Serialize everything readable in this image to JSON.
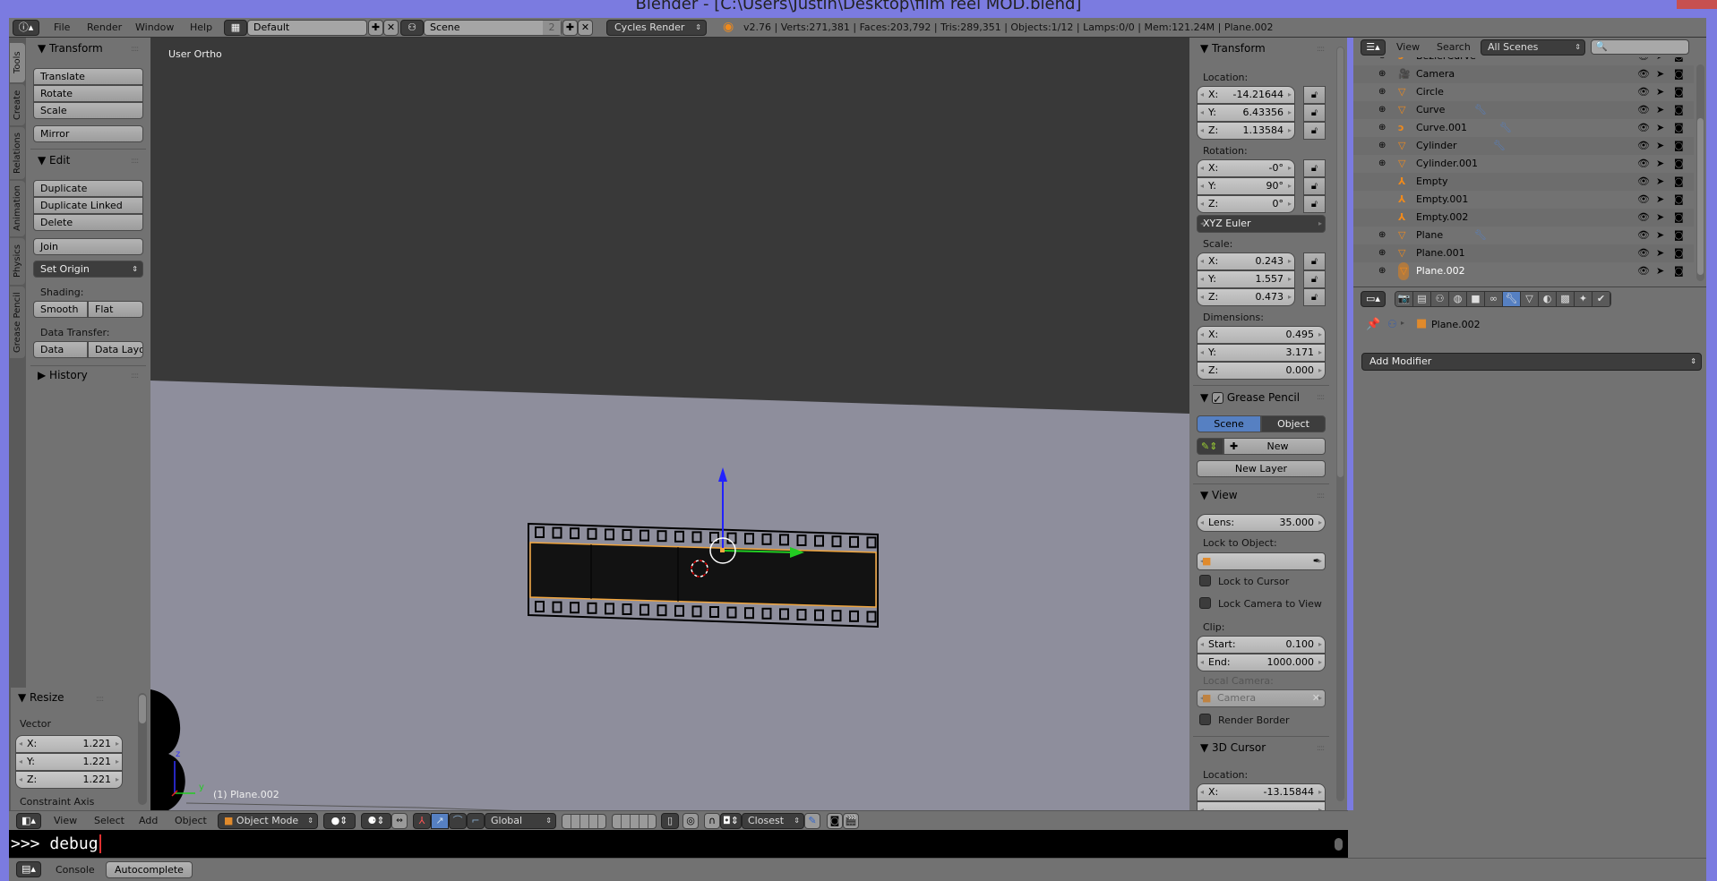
{
  "window": {
    "title": "Blender - [C:\\Users\\Justin\\Desktop\\film reel MOD.blend]"
  },
  "top_header": {
    "menus": [
      "File",
      "Render",
      "Window",
      "Help"
    ],
    "layout": "Default",
    "scene": "Scene",
    "scene_users": "2",
    "render_engine": "Cycles Render",
    "stats": "v2.76 | Verts:271,381 | Faces:203,792 | Tris:289,351 | Objects:1/12 | Lamps:0/0 | Mem:121.24M | Plane.002"
  },
  "tool_shelf": {
    "tabs": [
      "Tools",
      "Create",
      "Relations",
      "Animation",
      "Physics",
      "Grease Pencil"
    ],
    "transform": {
      "title": "Transform",
      "buttons": [
        "Translate",
        "Rotate",
        "Scale"
      ],
      "mirror": "Mirror"
    },
    "edit": {
      "title": "Edit",
      "buttons": [
        "Duplicate",
        "Duplicate Linked",
        "Delete"
      ],
      "join": "Join",
      "set_origin": "Set Origin",
      "shading_label": "Shading:",
      "smooth": "Smooth",
      "flat": "Flat",
      "data_transfer_label": "Data Transfer:",
      "data": "Data",
      "data_layout": "Data Layo"
    },
    "history": {
      "title": "History"
    }
  },
  "operator_panel": {
    "title": "Resize",
    "vector_label": "Vector",
    "x_label": "X:",
    "x": "1.221",
    "y_label": "Y:",
    "y": "1.221",
    "z_label": "Z:",
    "z": "1.221",
    "constraint": "Constraint Axis"
  },
  "viewport": {
    "view_name": "User Ortho",
    "object_info": "(1) Plane.002",
    "axis_z": "z",
    "axis_y": "y"
  },
  "n_panel": {
    "transform_title": "Transform",
    "location_label": "Location:",
    "location": {
      "x": "-14.21644",
      "y": "6.43356",
      "z": "1.13584"
    },
    "rotation_label": "Rotation:",
    "rotation": {
      "x": "-0°",
      "y": "90°",
      "z": "0°"
    },
    "rotation_mode": "XYZ Euler",
    "scale_label": "Scale:",
    "scale": {
      "x": "0.243",
      "y": "1.557",
      "z": "0.473"
    },
    "dimensions_label": "Dimensions:",
    "dimensions": {
      "x": "0.495",
      "y": "3.171",
      "z": "0.000"
    },
    "axis": {
      "x": "X:",
      "y": "Y:",
      "z": "Z:"
    },
    "grease_pencil_title": "Grease Pencil",
    "gp_scene": "Scene",
    "gp_object": "Object",
    "gp_new": "New",
    "gp_new_layer": "New Layer",
    "view_title": "View",
    "lens_label": "Lens:",
    "lens": "35.000",
    "lock_to_object_label": "Lock to Object:",
    "lock_to_cursor": "Lock to Cursor",
    "lock_camera_to_view": "Lock Camera to View",
    "clip_label": "Clip:",
    "clip_start_label": "Start:",
    "clip_start": "0.100",
    "clip_end_label": "End:",
    "clip_end": "1000.000",
    "local_camera_label": "Local Camera:",
    "local_camera": "Camera",
    "render_border": "Render Border",
    "cursor_title": "3D Cursor",
    "cursor_location_label": "Location:",
    "cursor_x": "-13.15844"
  },
  "outliner": {
    "view": "View",
    "search": "Search",
    "filter": "All Scenes",
    "search_placeholder": "",
    "items": [
      {
        "name": "BezierCurve",
        "icon": "curve"
      },
      {
        "name": "Camera",
        "icon": "camera"
      },
      {
        "name": "Circle",
        "icon": "mesh"
      },
      {
        "name": "Curve",
        "icon": "mesh",
        "modifier": true
      },
      {
        "name": "Curve.001",
        "icon": "curve",
        "modifier": true
      },
      {
        "name": "Cylinder",
        "icon": "mesh",
        "modifier": true
      },
      {
        "name": "Cylinder.001",
        "icon": "mesh"
      },
      {
        "name": "Empty",
        "icon": "empty"
      },
      {
        "name": "Empty.001",
        "icon": "empty"
      },
      {
        "name": "Empty.002",
        "icon": "empty"
      },
      {
        "name": "Plane",
        "icon": "mesh",
        "modifier": true
      },
      {
        "name": "Plane.001",
        "icon": "mesh"
      },
      {
        "name": "Plane.002",
        "icon": "mesh",
        "selected": true
      }
    ]
  },
  "properties": {
    "tabs": [
      "render",
      "render-layers",
      "scene",
      "world",
      "object",
      "constraints",
      "modifiers",
      "data",
      "material",
      "texture",
      "particles",
      "physics"
    ],
    "active_tab": "modifiers",
    "breadcrumb_object": "Plane.002",
    "add_modifier": "Add Modifier"
  },
  "view3d_header": {
    "menus": [
      "View",
      "Select",
      "Add",
      "Object"
    ],
    "mode": "Object Mode",
    "orientation": "Global",
    "snap_target": "Closest"
  },
  "console": {
    "prompt": ">>>",
    "input": "debug"
  },
  "console_header": {
    "console": "Console",
    "autocomplete": "Autocomplete"
  },
  "colors": {
    "accent_blue": "#5680c2",
    "selection_orange": "#f1a63f",
    "window_frame": "#7b7be0"
  }
}
